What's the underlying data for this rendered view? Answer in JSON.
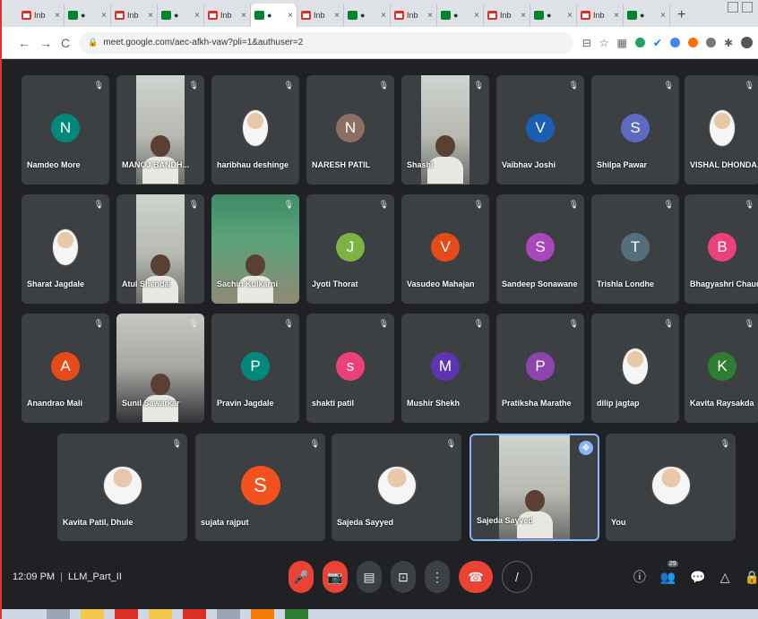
{
  "browser": {
    "tabs": [
      {
        "type": "gmail",
        "label": "Inb",
        "close": "×"
      },
      {
        "type": "meet",
        "label": "●",
        "close": "×"
      },
      {
        "type": "gmail",
        "label": "Inb",
        "close": "×"
      },
      {
        "type": "meet",
        "label": "●",
        "close": "×"
      },
      {
        "type": "gmail",
        "label": "Inb",
        "close": "×"
      },
      {
        "type": "meet",
        "label": "●",
        "close": "×",
        "active": true
      },
      {
        "type": "gmail",
        "label": "Inb",
        "close": "×"
      },
      {
        "type": "meet",
        "label": "●",
        "close": "×"
      },
      {
        "type": "gmail",
        "label": "Inb",
        "close": "×"
      },
      {
        "type": "meet",
        "label": "●",
        "close": "×"
      },
      {
        "type": "gmail",
        "label": "Inb",
        "close": "×"
      },
      {
        "type": "meet",
        "label": "●",
        "close": "×"
      },
      {
        "type": "gmail",
        "label": "Inb",
        "close": "×"
      },
      {
        "type": "meet",
        "label": "●",
        "close": "×"
      }
    ],
    "new_tab": "+",
    "url": "meet.google.com/aec-afkh-vaw?pli=1&authuser=2",
    "nav": {
      "back": "←",
      "forward": "→",
      "reload": "C"
    }
  },
  "participants": [
    {
      "name": "Namdeo More",
      "kind": "avatar",
      "initial": "N",
      "color": "#00897b"
    },
    {
      "name": "MANOJ BANDH...",
      "kind": "video"
    },
    {
      "name": "haribhau deshinge",
      "kind": "photo"
    },
    {
      "name": "NARESH PATIL",
      "kind": "avatar",
      "initial": "N",
      "color": "#8d6e63"
    },
    {
      "name": "Shashi",
      "kind": "video"
    },
    {
      "name": "Vaibhav Joshi",
      "kind": "avatar",
      "initial": "V",
      "color": "#1a5fb4"
    },
    {
      "name": "Shilpa Pawar",
      "kind": "avatar",
      "initial": "S",
      "color": "#5c6bc0"
    },
    {
      "name": "VISHAL DHONDA...",
      "kind": "photo"
    },
    {
      "name": "Sharat Jagdale",
      "kind": "photo"
    },
    {
      "name": "Atul Shendal",
      "kind": "video"
    },
    {
      "name": "Sachin Kulkarni",
      "kind": "video-green"
    },
    {
      "name": "Jyoti Thorat",
      "kind": "avatar",
      "initial": "J",
      "color": "#7cb342"
    },
    {
      "name": "Vasudeo Mahajan",
      "kind": "avatar",
      "initial": "V",
      "color": "#e64a19"
    },
    {
      "name": "Sandeep Sonawane",
      "kind": "avatar",
      "initial": "S",
      "color": "#ab47bc"
    },
    {
      "name": "Trishla Londhe",
      "kind": "avatar",
      "initial": "T",
      "color": "#546e7a"
    },
    {
      "name": "Bhagyashri Chaud...",
      "kind": "avatar",
      "initial": "B",
      "color": "#ec407a"
    },
    {
      "name": "Anandrao Mali",
      "kind": "avatar",
      "initial": "A",
      "color": "#e64a19"
    },
    {
      "name": "Sunil Sawarkar",
      "kind": "video-grey"
    },
    {
      "name": "Pravin Jagdale",
      "kind": "avatar",
      "initial": "P",
      "color": "#00897b"
    },
    {
      "name": "shakti patil",
      "kind": "avatar",
      "initial": "s",
      "color": "#ec407a"
    },
    {
      "name": "Mushir Shekh",
      "kind": "avatar",
      "initial": "M",
      "color": "#5e35b1"
    },
    {
      "name": "Pratiksha Marathe",
      "kind": "avatar",
      "initial": "P",
      "color": "#8e44ad"
    },
    {
      "name": "dilip jagtap",
      "kind": "photo"
    },
    {
      "name": "Kavita Raysakda",
      "kind": "avatar",
      "initial": "K",
      "color": "#2e7d32"
    },
    {
      "name": "Kavita Patil, Dhule",
      "kind": "photo"
    },
    {
      "name": "sujata rajput",
      "kind": "avatar",
      "initial": "S",
      "color": "#f4511e"
    },
    {
      "name": "Sajeda Sayyed",
      "kind": "photo"
    },
    {
      "name": "Sajeda Sayyed",
      "kind": "video",
      "pinned": true
    },
    {
      "name": "You",
      "kind": "photo"
    }
  ],
  "footer": {
    "time": "12:09 PM",
    "separator": "|",
    "meeting_name": "LLM_Part_II",
    "controls": {
      "mic": "🎤",
      "camera": "📷",
      "captions": "▤",
      "present": "⊡",
      "more": "⋮",
      "end": "☎",
      "ghost": "/"
    },
    "right": {
      "info": "ⓘ",
      "people": "👥",
      "people_count": "29",
      "chat": "💬",
      "activities": "△",
      "lock": "🔒"
    }
  }
}
